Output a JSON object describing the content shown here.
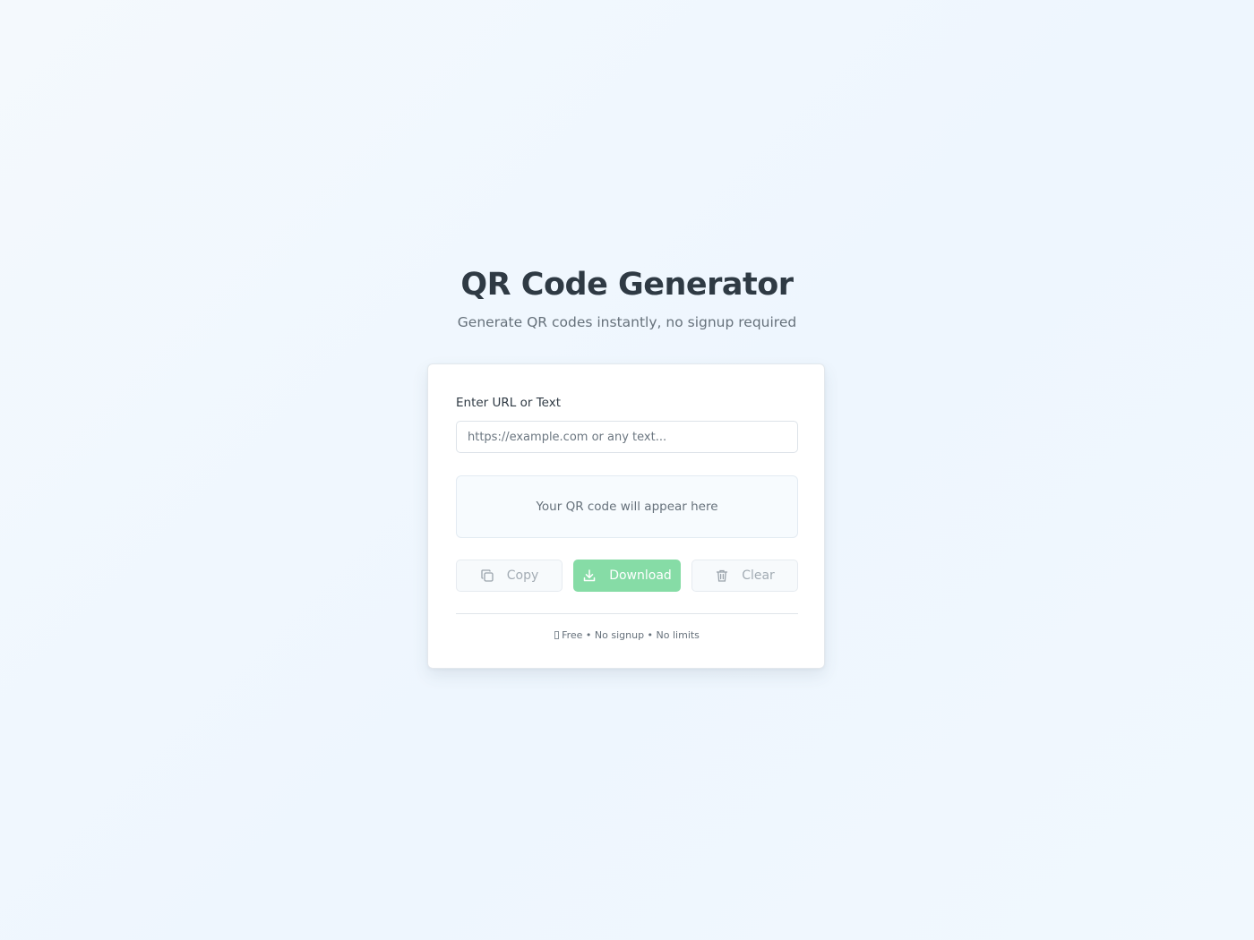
{
  "header": {
    "title": "QR Code Generator",
    "subtitle": "Generate QR codes instantly, no signup required"
  },
  "form": {
    "input_label": "Enter URL or Text",
    "input_placeholder": "https://example.com or any text...",
    "input_value": ""
  },
  "preview": {
    "placeholder_text": "Your QR code will appear here"
  },
  "actions": {
    "copy_label": "Copy",
    "copy_icon": "copy-icon",
    "download_label": "Download",
    "download_icon": "download-icon",
    "clear_label": "Clear",
    "clear_icon": "trash-icon"
  },
  "footer": {
    "note": "Free • No signup • No limits"
  },
  "colors": {
    "accent": "#86dca6",
    "title": "#2f3a44",
    "muted": "#66717b"
  }
}
